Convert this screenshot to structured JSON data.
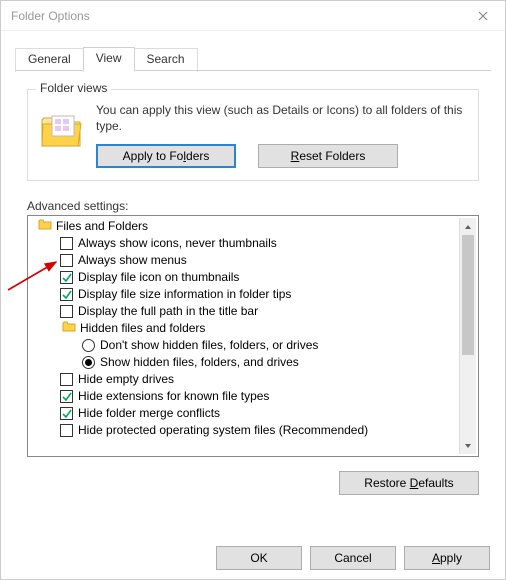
{
  "titlebar": {
    "title": "Folder Options"
  },
  "tabs": {
    "general": "General",
    "view": "View",
    "search": "Search"
  },
  "folder_views": {
    "legend": "Folder views",
    "text": "You can apply this view (such as Details or Icons) to all folders of this type.",
    "apply": "Apply to Folders",
    "reset": "Reset Folders"
  },
  "advanced": {
    "label": "Advanced settings:",
    "category": "Files and Folders",
    "items": [
      {
        "label": "Always show icons, never thumbnails",
        "checked": false
      },
      {
        "label": "Always show menus",
        "checked": false
      },
      {
        "label": "Display file icon on thumbnails",
        "checked": true
      },
      {
        "label": "Display file size information in folder tips",
        "checked": true
      },
      {
        "label": "Display the full path in the title bar",
        "checked": false
      }
    ],
    "hidden_group": {
      "label": "Hidden files and folders",
      "options": [
        {
          "label": "Don't show hidden files, folders, or drives",
          "selected": false
        },
        {
          "label": "Show hidden files, folders, and drives",
          "selected": true
        }
      ]
    },
    "items2": [
      {
        "label": "Hide empty drives",
        "checked": false
      },
      {
        "label": "Hide extensions for known file types",
        "checked": true
      },
      {
        "label": "Hide folder merge conflicts",
        "checked": true
      },
      {
        "label": "Hide protected operating system files (Recommended)",
        "checked": false
      }
    ]
  },
  "buttons": {
    "restore": "Restore Defaults",
    "ok": "OK",
    "cancel": "Cancel",
    "apply": "Apply"
  }
}
